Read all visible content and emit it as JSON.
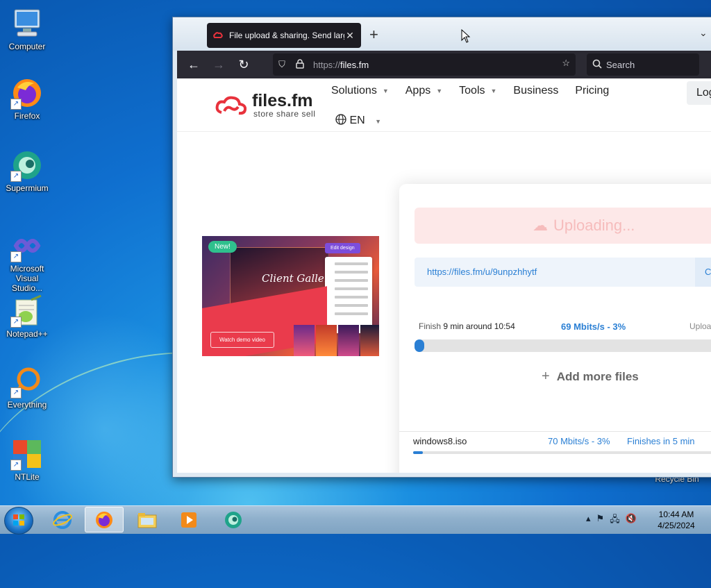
{
  "desktop": {
    "icons": [
      {
        "label": "Computer"
      },
      {
        "label": "Firefox"
      },
      {
        "label": "Supermium"
      },
      {
        "label": "Microsoft Visual Studio..."
      },
      {
        "label": "Notepad++"
      },
      {
        "label": "Everything"
      },
      {
        "label": "NTLite"
      }
    ],
    "recycle_bin": "Recycle Bin"
  },
  "browser": {
    "tab_title": "File upload & sharing. Send large files",
    "tab_close": "✕",
    "new_tab": "+",
    "url_prefix": "https://",
    "url_host": "files.fm",
    "search_placeholder": "Search"
  },
  "site": {
    "logo_name": "files.fm",
    "logo_tagline": "store share sell",
    "menu": [
      "Solutions",
      "Apps",
      "Tools",
      "Business",
      "Pricing"
    ],
    "language": "EN",
    "login_label": "Log in",
    "promo": {
      "badge": "New!",
      "edit_button": "Edit design",
      "gallery_title": "Client Gallery",
      "watch_button": "Watch demo video"
    },
    "upload": {
      "status_button": "Uploading...",
      "share_link": "https://files.fm/u/9unpzhhytf",
      "copy_label": "Copy",
      "finish_prefix": "Finish",
      "finish_eta": "9 min around 10:54",
      "speed": "69 Mbits/s - 3%",
      "upload_label": "Uploaded",
      "progress_fraction": 0.03,
      "add_more": "Add more files",
      "file": {
        "name": "windows8.iso",
        "speed": "70 Mbits/s - 3%",
        "finish": "Finishes in 5 min",
        "progress_fraction": 0.03
      }
    }
  },
  "taskbar": {
    "time": "10:44 AM",
    "date": "4/25/2024"
  }
}
